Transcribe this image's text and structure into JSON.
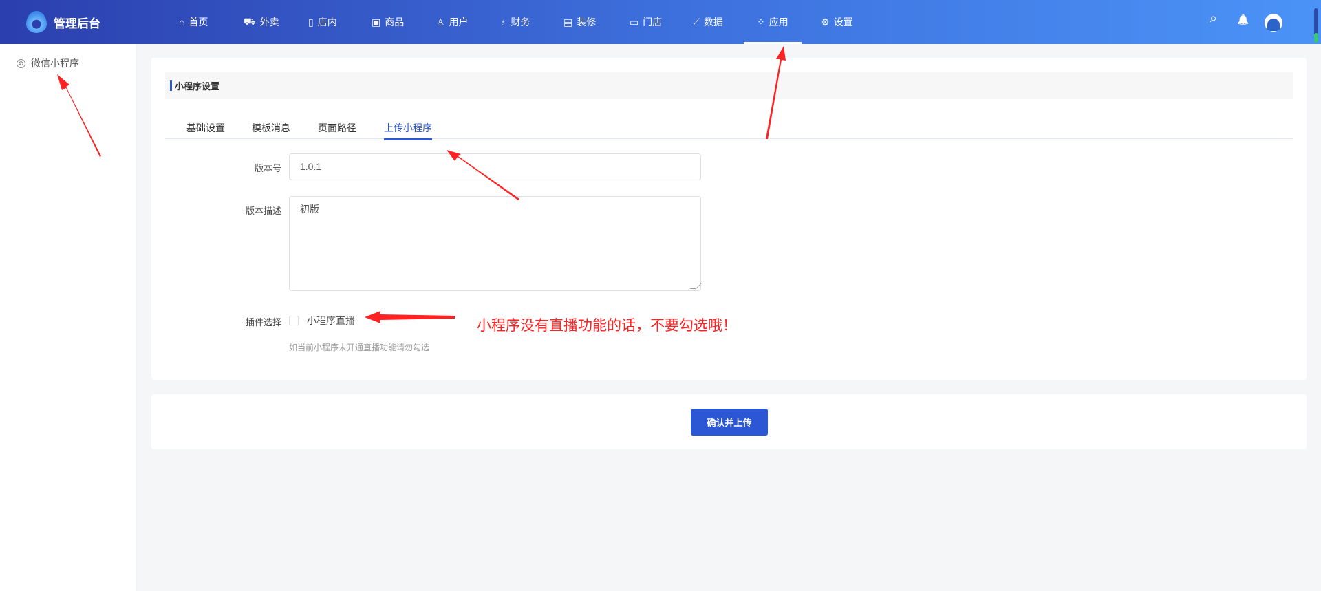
{
  "header": {
    "title": "管理后台",
    "nav": [
      {
        "label": "首页",
        "icon": "⌂"
      },
      {
        "label": "外卖",
        "icon": "⛟"
      },
      {
        "label": "店内",
        "icon": "▯"
      },
      {
        "label": "商品",
        "icon": "▣"
      },
      {
        "label": "用户",
        "icon": "♙"
      },
      {
        "label": "财务",
        "icon": "♁"
      },
      {
        "label": "装修",
        "icon": "▤"
      },
      {
        "label": "门店",
        "icon": "▭"
      },
      {
        "label": "数据",
        "icon": "⟋"
      },
      {
        "label": "应用",
        "icon": "⁘"
      },
      {
        "label": "设置",
        "icon": "⚙"
      }
    ],
    "active": "应用",
    "icons": {
      "search": "⌕",
      "bell": "🔔"
    }
  },
  "sidebar": {
    "items": [
      {
        "label": "微信小程序",
        "icon": "⊘"
      }
    ]
  },
  "main": {
    "section_title": "小程序设置",
    "tabs": [
      "基础设置",
      "模板消息",
      "页面路径",
      "上传小程序"
    ],
    "active_tab": "上传小程序",
    "form": {
      "version_label": "版本号",
      "version_value": "1.0.1",
      "desc_label": "版本描述",
      "desc_value": "初版",
      "plugin_label": "插件选择",
      "plugin_option": "小程序直播",
      "plugin_checked": false,
      "plugin_hint": "如当前小程序未开通直播功能请勿勾选"
    },
    "submit_label": "确认并上传"
  },
  "annotation": {
    "text": "小程序没有直播功能的话，不要勾选哦！",
    "color": "#ff2222"
  },
  "colors": {
    "accent": "#2b56d4"
  }
}
